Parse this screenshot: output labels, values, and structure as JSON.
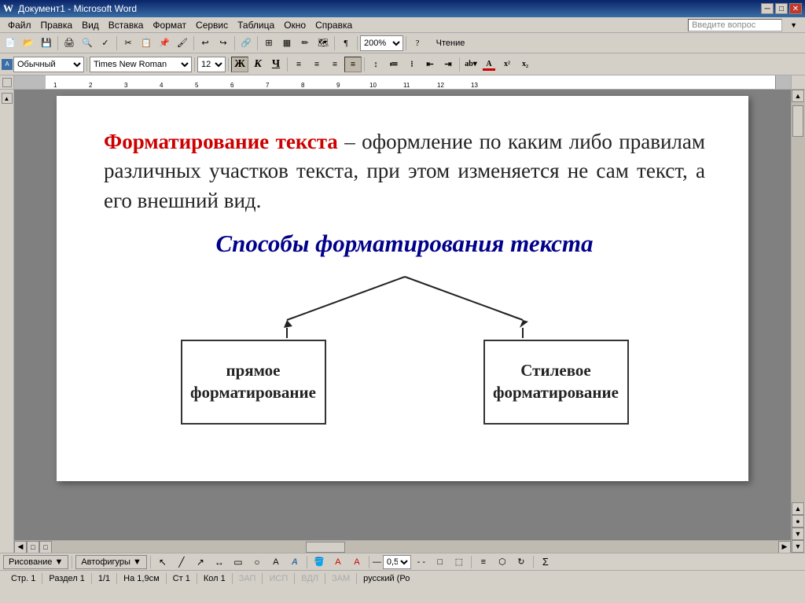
{
  "titlebar": {
    "title": "Документ1 - Microsoft Word",
    "icon": "W",
    "min_btn": "─",
    "max_btn": "□",
    "close_btn": "✕"
  },
  "menubar": {
    "items": [
      "Файл",
      "Правка",
      "Вид",
      "Вставка",
      "Формат",
      "Сервис",
      "Таблица",
      "Окно",
      "Справка"
    ],
    "help_placeholder": "Введите вопрос"
  },
  "toolbar": {
    "zoom": "200%",
    "view_btn": "Чтение"
  },
  "formattoolbar": {
    "style": "Обычный",
    "font": "Times New Roman",
    "size": "12",
    "bold": "Ж",
    "italic": "К",
    "underline": "Ч",
    "align_left": "≡",
    "align_center": "≡",
    "align_right": "≡",
    "justify": "≡"
  },
  "document": {
    "para1_red": "Форматирование текста",
    "para1_rest": " – оформление по каким либо правилам различных участков текста, при этом изменяется не сам текст, а его внешний вид.",
    "heading2": "Способы форматирования текста",
    "box_left_label": "прямое форматирование",
    "box_right_label": "Стилевое форматирование"
  },
  "statusbar": {
    "page": "Стр. 1",
    "section": "Раздел 1",
    "pages": "1/1",
    "position": "На 1,9см",
    "line": "Ст 1",
    "col": "Кол 1",
    "rec": "ЗАП",
    "ispr": "ИСП",
    "vdl": "ВДЛ",
    "zam": "ЗАМ",
    "lang": "русский (Ро"
  },
  "drawtoolbar": {
    "draw_label": "Рисование ▼",
    "autoshapes_label": "Автофигуры ▼",
    "size_value": "0,5"
  }
}
